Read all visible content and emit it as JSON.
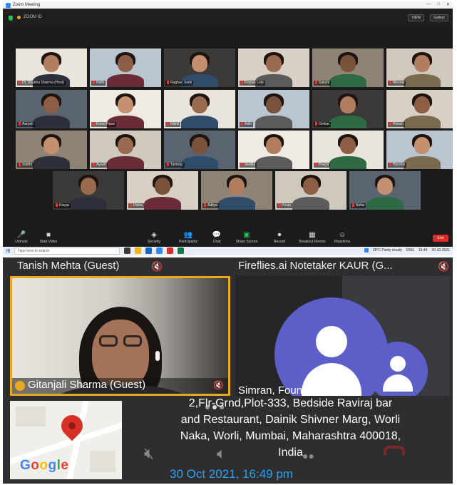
{
  "zoom": {
    "title": "Zoom Meeting",
    "window_controls": [
      "—",
      "□",
      "✕"
    ],
    "meeting_label": "ZOOM ID",
    "view_buttons": [
      "VIEW",
      "Gallery"
    ],
    "participants": [
      [
        "Dr. Shubha Sharma (Host)",
        "Nidhi",
        "Raghav Joshi",
        "Pranav Lele",
        "Sakshi",
        "Meenal"
      ],
      [
        "Aaryan",
        "Kunal Rane",
        "Nikhil",
        "Aditi",
        "Omkar",
        "Rohan"
      ],
      [
        "Siddhi",
        "Ayush",
        "Tanmay",
        "Vedika",
        "Prachi",
        "Harshal"
      ],
      [
        "Kavya",
        "Disha",
        "Aditya",
        "Pooja",
        "Neha"
      ]
    ],
    "toolbar": {
      "mute": "Unmute",
      "video": "Start Video",
      "security": "Security",
      "participants": "Participants",
      "chat": "Chat",
      "share": "Share Screen",
      "record": "Record",
      "breakout": "Breakout Rooms",
      "reactions": "Reactions",
      "end": "End"
    },
    "taskbar": {
      "search_placeholder": "Type here to search",
      "weather": "28°C Partly cloudy",
      "language": "ENG",
      "time": "16:49",
      "date": "30-10-2021"
    }
  },
  "phone": {
    "top_left_name": "Tanish Mehta (Guest)",
    "top_right_name": "Fireflies.ai Notetaker KAUR (G...",
    "spotlight_name": "Gitanjali Sharma (Guest)",
    "founder_name": "Simran, Founder",
    "address_lines": [
      "2,Flr-Grnd,Plot-333, Bedside Raviraj bar",
      "and Restaurant, Dainik Shivner Marg, Worli",
      "Naka, Worli, Mumbai, Maharashtra 400018,",
      "India"
    ],
    "map_brand": "Google",
    "timestamp": "30 Oct 2021, 16:49 pm"
  },
  "colors": {
    "spotlight_border": "#e8a820",
    "avatar": "#5b5fc7",
    "timestamp": "#29a3f4",
    "end_call": "#e02828"
  }
}
